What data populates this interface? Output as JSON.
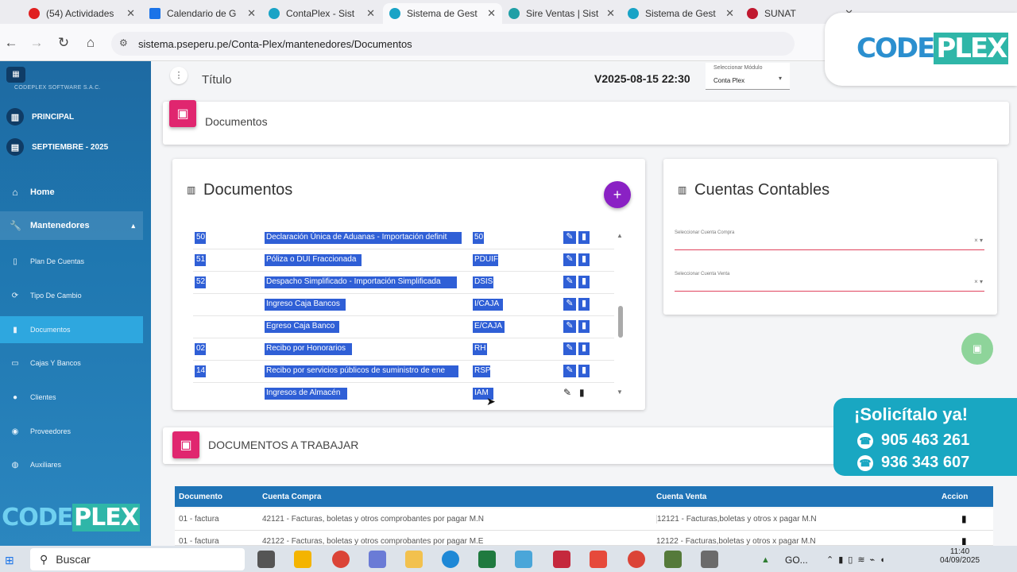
{
  "tabs": [
    {
      "title": "(54) Actividades",
      "color": "#e02020"
    },
    {
      "title": "Calendario de G",
      "color": "#1a73e8"
    },
    {
      "title": "ContaPlex - Sist",
      "color": "#19a3c6"
    },
    {
      "title": "Sistema de Gest",
      "color": "#19a3c6"
    },
    {
      "title": "Sire Ventas | Sist",
      "color": "#1f9fa6"
    },
    {
      "title": "Sistema de Gest",
      "color": "#19a3c6"
    },
    {
      "title": "SUNAT",
      "color": "#c0182f"
    }
  ],
  "url": "sistema.pseperu.pe/Conta-Plex/mantenedores/Documentos",
  "header": {
    "title": "Título",
    "version": "V2025-08-15 22:30",
    "module_label": "Seleccionar Módulo",
    "module_value": "Conta Plex"
  },
  "sidebar": {
    "company": "CODEPLEX SOFTWARE S.A.C.",
    "principal": "PRINCIPAL",
    "period": "SEPTIEMBRE - 2025",
    "home": "Home",
    "mantenedores": "Mantenedores",
    "items": [
      "Plan De Cuentas",
      "Tipo De Cambio",
      "Documentos",
      "Cajas Y Bancos",
      "Clientes",
      "Proveedores",
      "Auxiliares"
    ],
    "logo_text_left": "CODE",
    "logo_text_right": "PLEX"
  },
  "page": {
    "section_title": "Documentos"
  },
  "documentos": {
    "title": "Documentos",
    "rows": [
      {
        "code": "50",
        "name": "Declaración Única de Aduanas - Importación definit",
        "abbr": "50"
      },
      {
        "code": "51",
        "name": "Póliza o DUI Fraccionada",
        "abbr": "PDUIF"
      },
      {
        "code": "52",
        "name": "Despacho Simplificado - Importación Simplificada",
        "abbr": "DSIS"
      },
      {
        "code": "",
        "name": "Ingreso Caja Bancos",
        "abbr": "I/CAJA"
      },
      {
        "code": "",
        "name": "Egreso Caja Banco",
        "abbr": "E/CAJA"
      },
      {
        "code": "02",
        "name": "Recibo por Honorarios",
        "abbr": "RH"
      },
      {
        "code": "14",
        "name": "Recibo por servicios públicos de suministro de ene",
        "abbr": "RSP"
      },
      {
        "code": "",
        "name": "Ingresos de Almacén",
        "abbr": "IAM"
      }
    ]
  },
  "cuentas": {
    "title": "Cuentas Contables",
    "compra_label": "Seleccionar Cuenta Compra",
    "venta_label": "Seleccionar Cuenta Venta"
  },
  "trabajar": {
    "title": "DOCUMENTOS A TRABAJAR",
    "headers": [
      "Documento",
      "Cuenta Compra",
      "Cuenta Venta",
      "Accion"
    ],
    "rows": [
      {
        "doc": "01 - factura",
        "compra": "42121 - Facturas, boletas y otros comprobantes por pagar M.N",
        "venta": "12121 - Facturas,boletas y otros x pagar M.N"
      },
      {
        "doc": "01 - factura",
        "compra": "42122 - Facturas, boletas y otros comprobantes por pagar M.E",
        "venta": "12122 - Facturas,boletas y otros x pagar M.N"
      }
    ]
  },
  "promo": {
    "headline": "¡Solicítalo ya!",
    "phone1": "905 463 261",
    "phone2": "936 343 607",
    "logo_left": "CODE",
    "logo_right": "PLEX"
  },
  "taskbar": {
    "search": "Buscar",
    "tray_app": "GO...",
    "time": "11:40",
    "date": "04/09/2025"
  }
}
